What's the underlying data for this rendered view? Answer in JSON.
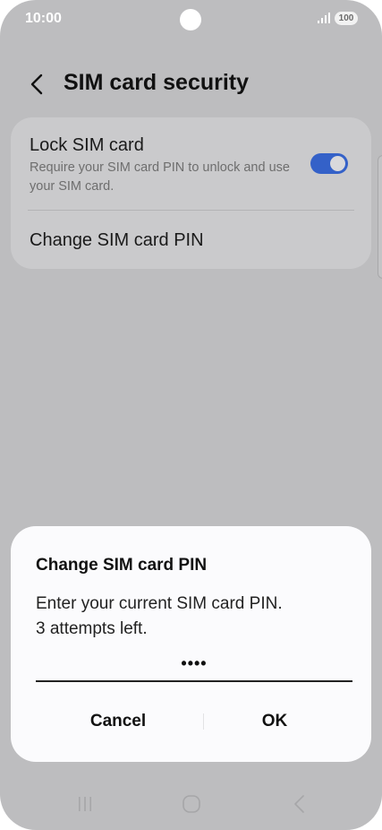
{
  "status_bar": {
    "time": "10:00",
    "battery": "100",
    "icons": [
      "signal-icon",
      "battery-icon"
    ]
  },
  "header": {
    "title": "SIM card security",
    "back_icon": "chevron-left-icon"
  },
  "settings": {
    "lock_sim": {
      "title": "Lock SIM card",
      "description": "Require your SIM card PIN to unlock and use your SIM card.",
      "enabled": true
    },
    "change_pin": {
      "label": "Change SIM card PIN"
    }
  },
  "dialog": {
    "title": "Change SIM card PIN",
    "message_line1": "Enter your current SIM card PIN.",
    "message_line2": "3 attempts left.",
    "pin_value": "••••",
    "cancel_label": "Cancel",
    "ok_label": "OK"
  },
  "nav_bar": {
    "icons": [
      "recents-icon",
      "home-icon",
      "back-icon"
    ]
  },
  "colors": {
    "accent": "#3461c8",
    "scrim_background": "#bdbdbf",
    "dialog_background": "#fbfbfd"
  }
}
